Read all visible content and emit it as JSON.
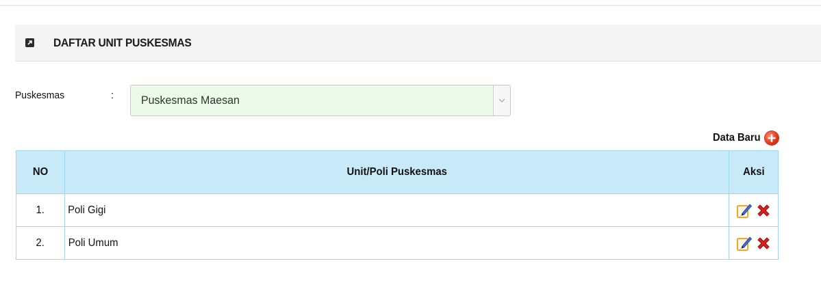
{
  "panel": {
    "title": "DAFTAR UNIT PUSKESMAS",
    "icon": "external-link-icon"
  },
  "filter": {
    "label": "Puskesmas",
    "separator": ":",
    "selected_value": "Puskesmas Maesan"
  },
  "actions": {
    "new_label": "Data Baru",
    "new_icon": "plus-circle-icon"
  },
  "table": {
    "headers": {
      "no": "NO",
      "unit": "Unit/Poli Puskesmas",
      "aksi": "Aksi"
    },
    "rows": [
      {
        "no": "1.",
        "unit": "Poli Gigi"
      },
      {
        "no": "2.",
        "unit": "Poli Umum"
      }
    ],
    "row_icons": [
      "edit-icon",
      "delete-icon"
    ]
  },
  "colors": {
    "header_bg": "#c7e9f8",
    "border": "#9fd6ee",
    "select_bg": "#ecfbe9",
    "delete_red": "#d61f1f",
    "edit_orange": "#f5a623"
  }
}
